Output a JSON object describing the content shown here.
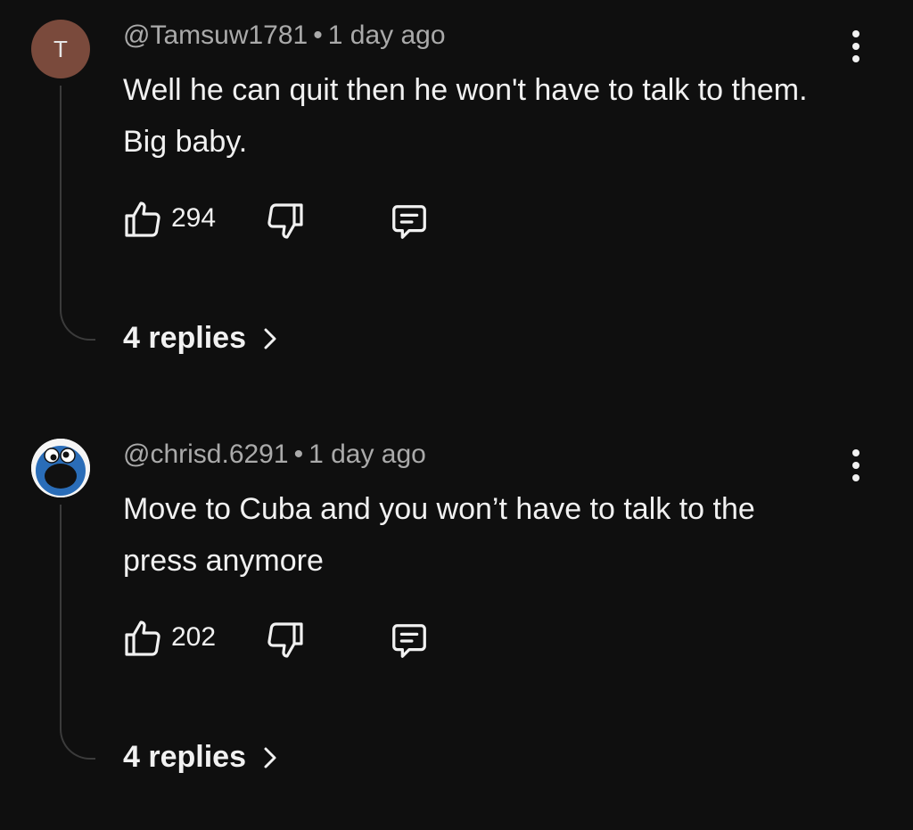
{
  "comments": [
    {
      "avatar_letter": "T",
      "avatar_color": "#7a4a3c",
      "author": "@Tamsuw1781",
      "separator": "•",
      "time": "1 day ago",
      "text": "Well he can quit then he won't have to talk to them. Big baby.",
      "likes": "294",
      "replies": "4 replies"
    },
    {
      "avatar_letter": "",
      "author": "@chrisd.6291",
      "separator": "•",
      "time": "1 day ago",
      "text": "Move to Cuba and you won’t have to talk to the press anymore",
      "likes": "202",
      "replies": "4 replies"
    }
  ],
  "icons": {
    "like": "thumbs-up-icon",
    "dislike": "thumbs-down-icon",
    "reply": "reply-comment-icon",
    "more": "more-vertical-icon",
    "chevron": "chevron-right-icon"
  },
  "colors": {
    "background": "#0f0f0f",
    "text": "#f1f1f1",
    "meta": "#aaaaaa"
  }
}
